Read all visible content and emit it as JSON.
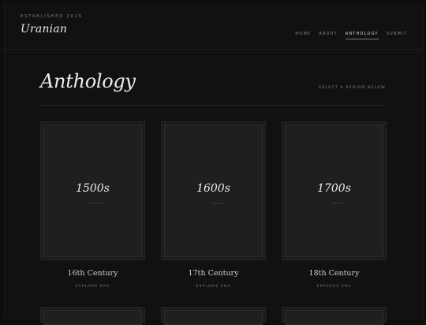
{
  "header": {
    "established": "ESTABLISHED 2025",
    "logo": "Uranian",
    "nav": [
      {
        "label": "HOME"
      },
      {
        "label": "ABOUT"
      },
      {
        "label": "ANTHOLOGY",
        "active": true
      },
      {
        "label": "SUBMIT"
      }
    ]
  },
  "main": {
    "title": "Anthology",
    "subtitle": "SELECT A PERIOD BELOW",
    "cards": [
      {
        "era": "1500s",
        "century": "16th Century",
        "action": "EXPLORE ERA"
      },
      {
        "era": "1600s",
        "century": "17th Century",
        "action": "EXPLORE ERA"
      },
      {
        "era": "1700s",
        "century": "18th Century",
        "action": "EXPLORE ERA"
      }
    ]
  },
  "colors": {
    "background": "#111111",
    "card": "#1f1f1f",
    "text": "#ececec",
    "muted": "#8a8a8a"
  }
}
